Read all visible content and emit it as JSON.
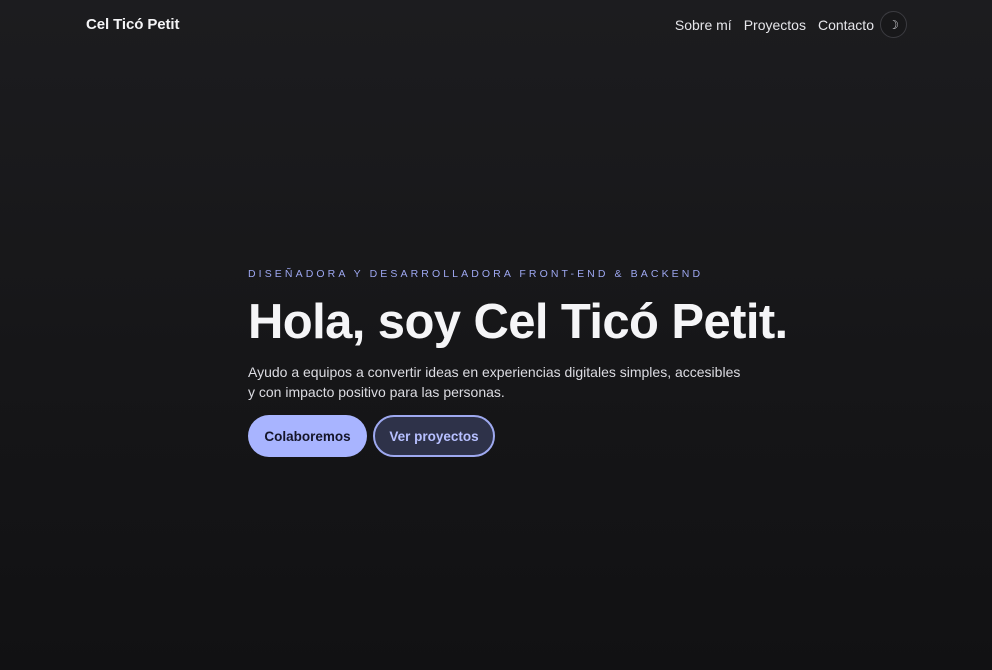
{
  "header": {
    "brand": "Cel Ticó Petit",
    "nav": [
      {
        "label": "Sobre mí"
      },
      {
        "label": "Proyectos"
      },
      {
        "label": "Contacto"
      }
    ],
    "theme_toggle_icon": "moon-icon",
    "theme_toggle_glyph": "☽"
  },
  "hero": {
    "eyebrow": "DISEÑADORA Y DESARROLLADORA FRONT-END & BACKEND",
    "headline": "Hola, soy Cel Ticó Petit.",
    "lead": "Ayudo a equipos a convertir ideas en experiencias digitales simples, accesibles y con impacto positivo para las personas.",
    "primary_cta": "Colaboremos",
    "secondary_cta": "Ver proyectos"
  },
  "colors": {
    "background": "#161618",
    "accent": "#a8b4ff",
    "eyebrow": "#9da7f0",
    "secondary_button_bg": "#2e3249"
  }
}
